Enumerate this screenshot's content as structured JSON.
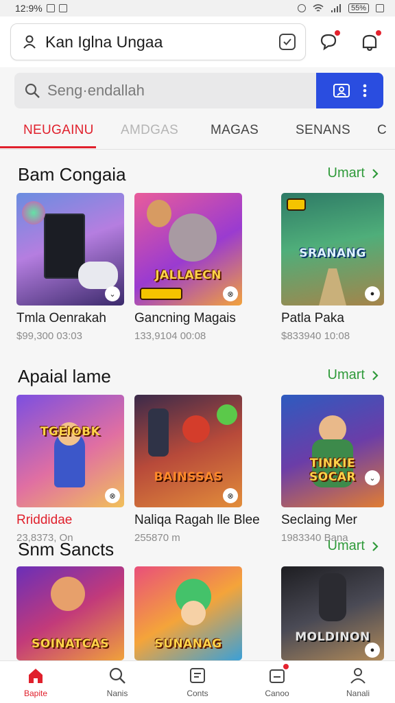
{
  "status_bar": {
    "time": "12:9%",
    "battery": "55%"
  },
  "account": {
    "name": "Kan Iglna Ungaa"
  },
  "search": {
    "placeholder": "Seng·endallah"
  },
  "tabs": [
    {
      "label": "NEUGAINU",
      "active": true
    },
    {
      "label": "AMDGAS"
    },
    {
      "label": "MAGAS"
    },
    {
      "label": "SENANS"
    },
    {
      "label": "C"
    }
  ],
  "sections": [
    {
      "title": "Bam Congaia",
      "see_all": "Umart",
      "items": [
        {
          "title": "Tmla Oenrakah",
          "meta": "$99,300 03:03",
          "logo": ""
        },
        {
          "title": "Gancning Magais",
          "meta": "133,9104 00:08",
          "logo": "JALLAECN"
        },
        {
          "title": "Patla Paka",
          "meta": "$833940 10:08",
          "logo": "SRANANG"
        }
      ]
    },
    {
      "title": "Apaial lame",
      "see_all": "Umart",
      "items": [
        {
          "title": "Rriddidae",
          "meta": "23,8373, On",
          "logo": "TGEIOBK"
        },
        {
          "title": "Naliqa Ragah lle Blee",
          "meta": "255870 m",
          "logo": "BAINSSAS"
        },
        {
          "title": "Seclaing Mer",
          "meta": "1983340 Bana",
          "logo": "TINKIE SOCAR"
        }
      ]
    },
    {
      "title": "Snm Sancts",
      "see_all": "Umart",
      "items": [
        {
          "title": "",
          "meta": "",
          "logo": "SOINATCAS"
        },
        {
          "title": "",
          "meta": "",
          "logo": "SUNANAG"
        },
        {
          "title": "",
          "meta": "",
          "logo": "MOLDINON"
        }
      ]
    }
  ],
  "bottom_nav": [
    {
      "label": "Bapite",
      "icon": "home-icon",
      "active": true
    },
    {
      "label": "Nanis",
      "icon": "search-icon"
    },
    {
      "label": "Conts",
      "icon": "list-icon"
    },
    {
      "label": "Canoo",
      "icon": "inbox-icon"
    },
    {
      "label": "Nanali",
      "icon": "profile-icon"
    }
  ],
  "colors": {
    "accent": "#e0202c",
    "primary_blue": "#2a4de0",
    "link_green": "#2f9a3a"
  }
}
